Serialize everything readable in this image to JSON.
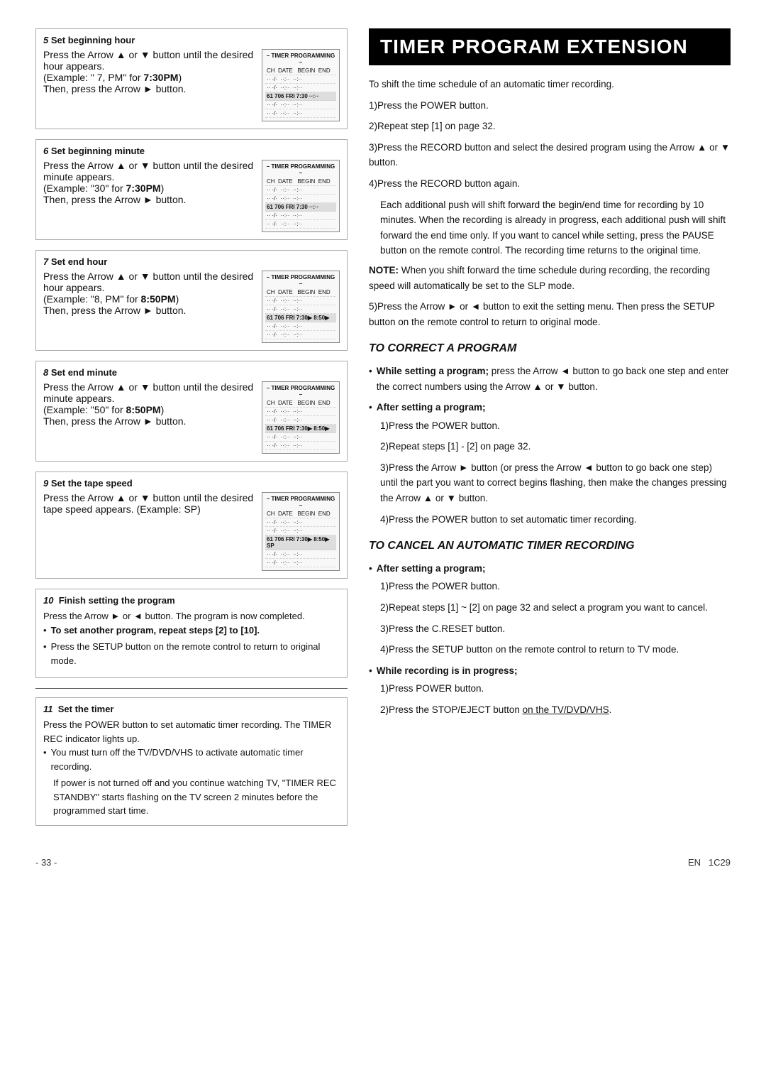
{
  "page": {
    "footer": {
      "page_number": "- 33 -",
      "lang": "EN",
      "code": "1C29"
    }
  },
  "left": {
    "sections": [
      {
        "id": "step5",
        "step": "5",
        "title": "Set beginning hour",
        "body": "Press the Arrow ▲ or ▼ button until the desired hour appears.\n(Example: \" 7, PM\" for 7:30PM)\nThen, press the Arrow ► button.",
        "bold_part": "7:30PM",
        "display": {
          "title": "– TIMER PROGRAMMING –",
          "cols": "CH  DATE    BEGIN  END",
          "rows": [
            "·· ·/·  ··:··  ··:··",
            "·· ·/·  ··:··  ··:··",
            "61 706 FRI  7:30▶  ··:··",
            "·· ·/·  ··:··  ··:··",
            "·· ·/·  ··:··  ··:··"
          ]
        }
      },
      {
        "id": "step6",
        "step": "6",
        "title": "Set beginning minute",
        "body": "Press the Arrow ▲ or ▼ button until the desired minute appears.\n(Example: \"30\" for 7:30PM)\nThen, press the Arrow ► button.",
        "bold_part": "7:30PM",
        "display": {
          "title": "– TIMER PROGRAMMING –",
          "cols": "CH  DATE    BEGIN  END",
          "rows": [
            "·· ·/·  ··:··  ··:··",
            "·· ·/·  ··:··  ··:··",
            "61 706 FRI  7:30▶  ··:··",
            "·· ·/·  ··:··  ··:··",
            "·· ·/·  ··:··  ··:··"
          ]
        }
      },
      {
        "id": "step7",
        "step": "7",
        "title": "Set end hour",
        "body": "Press the Arrow ▲ or ▼ button until the desired hour appears.\n(Example: \"8, PM\" for 8:50PM)\nThen, press the Arrow ► button.",
        "bold_part": "8:50PM",
        "display": {
          "title": "– TIMER PROGRAMMING –",
          "cols": "CH  DATE    BEGIN  END",
          "rows": [
            "·· ·/·  ··:··  ··:··",
            "·· ·/·  ··:··  ··:··",
            "61 706 FRI  7:30▶ 8:50▶",
            "·· ·/·  ··:··  ··:··",
            "·· ·/·  ··:··  ··:··"
          ]
        }
      },
      {
        "id": "step8",
        "step": "8",
        "title": "Set end minute",
        "body": "Press the Arrow ▲ or ▼ button until the desired minute appears.\n(Example: \"50\" for 8:50PM)\nThen, press the Arrow ► button.",
        "bold_part": "8:50PM",
        "display": {
          "title": "– TIMER PROGRAMMING –",
          "cols": "CH  DATE    BEGIN  END",
          "rows": [
            "·· ·/·  ··:··  ··:··",
            "·· ·/·  ··:··  ··:··",
            "61 706 FRI  7:30▶ 8:50▶",
            "·· ·/·  ··:··  ··:··",
            "·· ·/·  ··:··  ··:··"
          ]
        }
      },
      {
        "id": "step9",
        "step": "9",
        "title": "Set the tape speed",
        "body": "Press the Arrow ▲ or ▼ button until the desired tape speed appears. (Example: SP)",
        "bold_part": "",
        "display": {
          "title": "– TIMER PROGRAMMING –",
          "cols": "CH  DATE    BEGIN  END",
          "rows": [
            "·· ·/·  ··:··  ··:··",
            "·· ·/·  ··:··  ··:··",
            "61 706 FRI  7:30▶ 8:50▶ SP",
            "·· ·/·  ··:··  ··:··",
            "·· ·/·  ··:··  ··:··"
          ]
        }
      }
    ],
    "step10": {
      "step": "10",
      "title": "Finish setting the program",
      "body": "Press the Arrow ► or ◄ button. The program is now completed.",
      "bullets": [
        "To set another program, repeat steps [2] to [10].",
        "Press the SETUP button on the remote control to return to original mode."
      ]
    },
    "step11": {
      "step": "11",
      "title": "Set the timer",
      "body": "Press the POWER button to set automatic timer recording. The TIMER REC indicator lights up.",
      "bullets": [
        "You must turn off the TV/DVD/VHS to activate automatic timer recording.",
        "If power is not turned off and you continue watching TV, \"TIMER REC STANDBY\" starts flashing on the TV screen 2 minutes before the programmed start time."
      ]
    }
  },
  "right": {
    "title": "TIMER PROGRAM EXTENSION",
    "intro": "To shift the time schedule of an automatic timer recording.",
    "steps": [
      "1)Press the POWER button.",
      "2)Repeat step [1] on page 32.",
      "3)Press the RECORD button and select the desired program using the Arrow ▲ or ▼ button.",
      "4)Press the RECORD button again."
    ],
    "step4_detail": "Each additional push will shift forward the begin/end time for recording by 10 minutes. When the recording is already in progress, each additional push will shift forward the end time only. If you want to cancel while setting, press the PAUSE button on the remote control. The recording time returns to the original time.",
    "note": "NOTE: When you shift forward the time schedule during recording, the recording speed will automatically be set to the SLP mode.",
    "step5": "5)Press the Arrow ► or ◄ button to exit the setting menu. Then press the SETUP button on the remote control to return to original mode.",
    "correct_title": "TO CORRECT A PROGRAM",
    "correct_while": {
      "label": "While setting a program;",
      "text": "press the Arrow ◄ button to go back one step and enter the correct numbers using the Arrow ▲ or ▼ button."
    },
    "correct_after": {
      "label": "After setting a program;",
      "steps": [
        "1)Press the POWER button.",
        "2)Repeat steps [1] - [2] on page 32.",
        "3)Press the Arrow ► button (or press the Arrow ◄ button to go back one step) until the part you want to correct begins flashing, then make the changes pressing the Arrow ▲ or ▼ button.",
        "4)Press the POWER button to set automatic timer recording."
      ]
    },
    "cancel_title": "TO CANCEL AN AUTOMATIC TIMER RECORDING",
    "cancel_after": {
      "label": "After setting a program;",
      "steps": [
        "1)Press the POWER button.",
        "2)Repeat steps [1] ~ [2] on page 32 and select a program you want to cancel.",
        "3)Press the C.RESET button.",
        "4)Press the SETUP button on the remote control to return to TV mode."
      ]
    },
    "cancel_while": {
      "label": "While recording is in progress;",
      "steps": [
        "1)Press POWER button.",
        "2)Press the STOP/EJECT button on the TV/DVD/VHS."
      ]
    }
  }
}
